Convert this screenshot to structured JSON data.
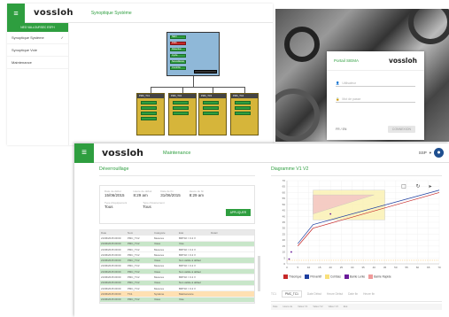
{
  "synoptique": {
    "logo": "vossloh",
    "title": "Synoptique Système",
    "side_header": "NEO VALLOURSEC ESFH",
    "side_items": [
      "Synoptique Système",
      "Synoptique Voie",
      "Maintenance"
    ],
    "root_tags": [
      "NEO",
      "PMC",
      "Détection",
      "Cycle",
      "Surveillance",
      "Contrôle"
    ],
    "child_labels": [
      "PMC_TC1",
      "PMC_TC2",
      "PMC_TC3",
      "PMC_TC4",
      "PMC_TC5"
    ]
  },
  "portal": {
    "title": "Portail SIEMA",
    "logo": "vossloh",
    "username_placeholder": "Utilisateur",
    "password_placeholder": "Mot de passe",
    "version": "FR / EN",
    "connect_label": "CONNEXION"
  },
  "maintenance": {
    "logo": "vossloh",
    "page_title": "Maintenance",
    "user_label": "SSP",
    "user_chevron": "▾",
    "left_title": "Déverrouillage",
    "filters": {
      "start_label": "Date de début",
      "start_date": "15/06/2015",
      "start_time_label": "Heure de début",
      "start_time": "8:29 am",
      "end_label": "Date de fin",
      "end_date": "31/06/2015",
      "end_time_label": "Heure de fin",
      "end_time": "8:29 am",
      "equip_label": "Type d'équipement",
      "equip_value": "Tous",
      "event_label": "Type d'événement",
      "event_value": "Tous",
      "apply_label": "APPLIQUER"
    },
    "table": {
      "headers": [
        "Date",
        "Nom",
        "Catégorie",
        "Etat",
        "Détail"
      ],
      "rows": [
        {
          "date": "21/06/2015 09:00",
          "name": "PMC_TC2",
          "cat": "Mesures",
          "etat": "BRT02 = 0.2 V",
          "style": ""
        },
        {
          "date": "21/06/2015 09:00",
          "name": "PMC_TC2",
          "cat": "Voies",
          "etat": "Voie",
          "style": "green"
        },
        {
          "date": "21/06/2015 09:00",
          "name": "PMC_TC2",
          "cat": "Mesures",
          "etat": "BRT02 = 0.2 V",
          "style": ""
        },
        {
          "date": "21/06/2015 09:00",
          "name": "PMC_TC2",
          "cat": "Mesures",
          "etat": "BRT02 = 0.2 V",
          "style": ""
        },
        {
          "date": "21/06/2015 09:00",
          "name": "PMC_TC2",
          "cat": "Voies",
          "etat": "Non valide à défaut",
          "style": "green"
        },
        {
          "date": "21/06/2015 09:00",
          "name": "PMC_TC2",
          "cat": "Mesures",
          "etat": "BRT02 = 0.2 V",
          "style": ""
        },
        {
          "date": "21/06/2015 09:00",
          "name": "PMC_TC2",
          "cat": "Voies",
          "etat": "Non valide à défaut",
          "style": "green"
        },
        {
          "date": "21/06/2015 09:00",
          "name": "PMC_TC2",
          "cat": "Mesures",
          "etat": "BRT02 = 0.2 V",
          "style": ""
        },
        {
          "date": "21/06/2015 09:00",
          "name": "PMC_TC2",
          "cat": "Voies",
          "etat": "Non valide à défaut",
          "style": "green"
        },
        {
          "date": "21/06/2015 09:00",
          "name": "PMC_TC2",
          "cat": "Mesures",
          "etat": "BRT02 = 0.2 V",
          "style": ""
        },
        {
          "date": "21/06/2015 09:00",
          "name": "TC1",
          "cat": "Système",
          "etat": "Maintenance",
          "style": "orange"
        },
        {
          "date": "21/06/2015 09:00",
          "name": "PMC_TC2",
          "cat": "Voies",
          "etat": "Voie",
          "style": "green"
        }
      ]
    },
    "chart_title": "Diagramme V1 V2",
    "legend": [
      {
        "label": "Théorique",
        "color": "#c62828"
      },
      {
        "label": "Préventif",
        "color": "#1e3fa0"
      },
      {
        "label": "Coll Bas",
        "color": "#f9e07a"
      },
      {
        "label": "Barrie Lente",
        "color": "#6a1b9a"
      },
      {
        "label": "Barrie Rapide",
        "color": "#ef9a9a"
      }
    ],
    "tabs": [
      "TC1",
      "PMC_TC1",
      "Date Début",
      "Heure Début",
      "Date fin",
      "Heure fin"
    ],
    "bottom_headers": [
      "Date",
      "Heure de",
      "Valeur V1",
      "Valeur V2",
      "Valeur V3",
      "Etat"
    ]
  },
  "chart_data": {
    "type": "line",
    "title": "Diagramme V1 V2",
    "xlabel": "",
    "ylabel": "",
    "x_ticks": [
      0,
      5,
      10,
      15,
      20,
      25,
      30,
      35,
      40,
      45,
      50,
      55,
      60,
      65,
      70
    ],
    "y_ticks": [
      0,
      5,
      10,
      15,
      20,
      25,
      30,
      35,
      40,
      45,
      50,
      55,
      60,
      65,
      70
    ],
    "xlim": [
      0,
      70
    ],
    "ylim": [
      0,
      70
    ],
    "series": [
      {
        "name": "Théorique",
        "points": [
          [
            5,
            15
          ],
          [
            12,
            30
          ],
          [
            70,
            60
          ]
        ]
      },
      {
        "name": "Préventif",
        "points": [
          [
            5,
            17
          ],
          [
            12,
            33
          ],
          [
            70,
            62
          ]
        ]
      }
    ],
    "scatter": [
      [
        2,
        10
      ],
      [
        1,
        4
      ],
      [
        20,
        42
      ]
    ],
    "regions": [
      {
        "name": "Coll Bas",
        "polygon": [
          [
            12,
            37
          ],
          [
            45,
            37
          ],
          [
            45,
            62
          ],
          [
            12,
            62
          ]
        ]
      },
      {
        "name": "Barrie Rapide",
        "polygon": [
          [
            12,
            42
          ],
          [
            40,
            58
          ],
          [
            12,
            58
          ]
        ]
      }
    ]
  }
}
